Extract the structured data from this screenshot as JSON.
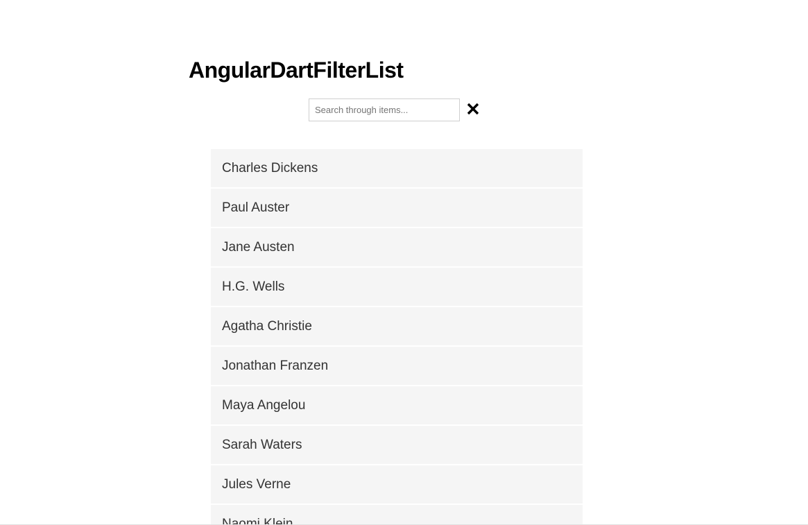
{
  "header": {
    "title": "AngularDartFilterList"
  },
  "search": {
    "placeholder": "Search through items...",
    "value": "",
    "clear_icon": "close-icon"
  },
  "list": {
    "items": [
      {
        "label": "Charles Dickens"
      },
      {
        "label": "Paul Auster"
      },
      {
        "label": "Jane Austen"
      },
      {
        "label": "H.G. Wells"
      },
      {
        "label": "Agatha Christie"
      },
      {
        "label": "Jonathan Franzen"
      },
      {
        "label": "Maya Angelou"
      },
      {
        "label": "Sarah Waters"
      },
      {
        "label": "Jules Verne"
      },
      {
        "label": "Naomi Klein"
      }
    ]
  },
  "colors": {
    "item_background": "#f5f5f5",
    "item_text": "#333333",
    "title_text": "#000000"
  }
}
